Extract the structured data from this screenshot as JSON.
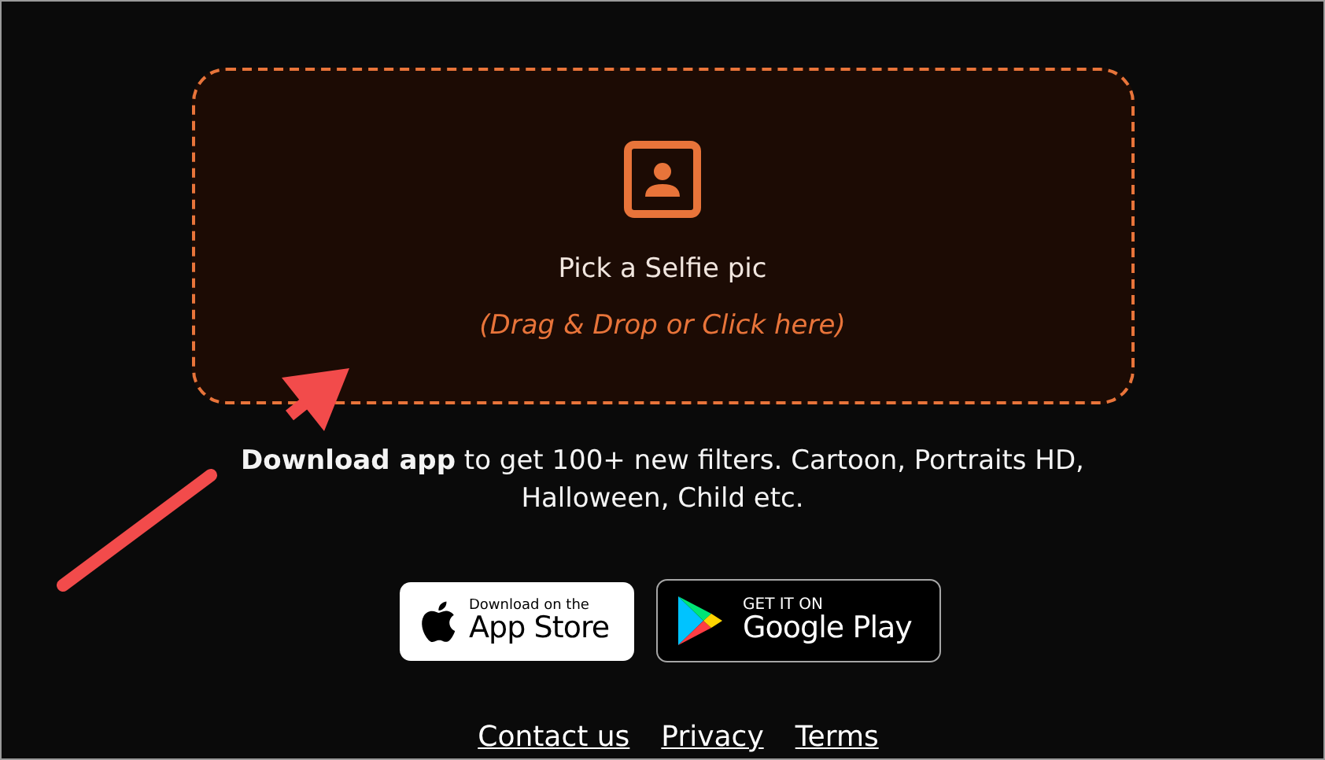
{
  "upload": {
    "title": "Pick a Selfie pic",
    "hint": "(Drag & Drop or Click here)"
  },
  "promo": "**Download app** to get 100+ new filters. Cartoon, Portraits HD, Halloween, Child etc.",
  "store_badges": [
    {
      "kind": "apple",
      "small": "Download on the",
      "big": "App Store"
    },
    {
      "kind": "google",
      "small": "GET IT ON",
      "big": "Google Play"
    }
  ],
  "footer_links": [
    "Contact us",
    "Privacy",
    "Terms"
  ]
}
